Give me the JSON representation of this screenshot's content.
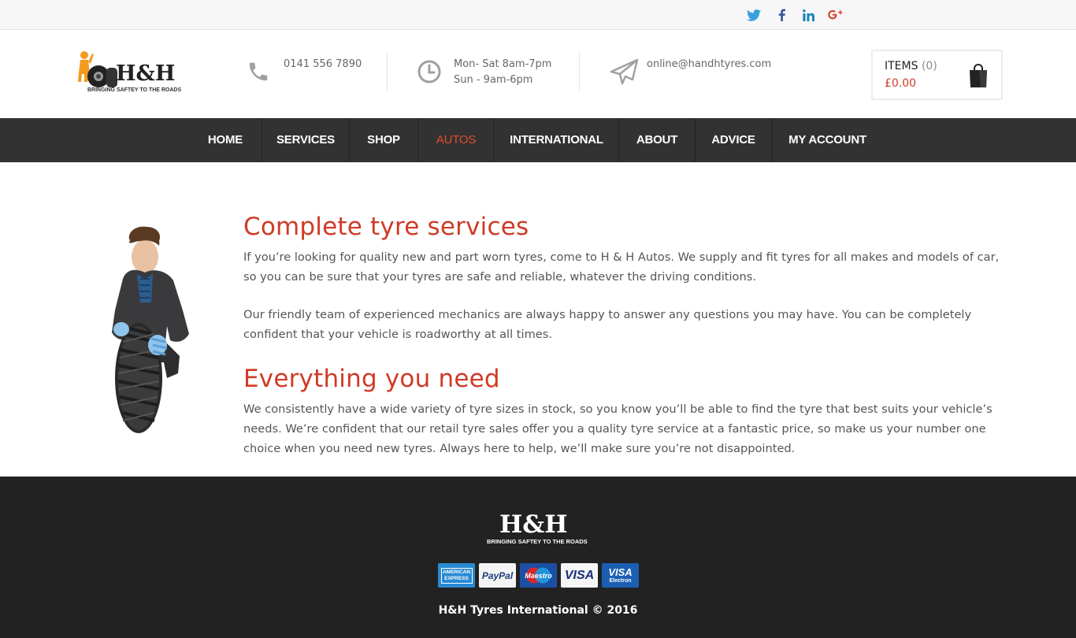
{
  "topbar": {
    "social": [
      {
        "name": "twitter-icon",
        "color": "#3aa0dd"
      },
      {
        "name": "facebook-icon",
        "color": "#3b5a9a"
      },
      {
        "name": "linkedin-icon",
        "color": "#1d84bd"
      },
      {
        "name": "google-plus-icon",
        "color": "#d3452f"
      }
    ]
  },
  "header": {
    "logo": {
      "text": "H&H",
      "tagline": "BRINGING SAFTEY TO THE ROADS"
    },
    "phone": {
      "icon": "phone-icon",
      "text": "0141 556 7890"
    },
    "hours": {
      "icon": "clock-icon",
      "line1": "Mon- Sat 8am-7pm",
      "line2": "Sun - 9am-6pm"
    },
    "email": {
      "icon": "paper-plane-icon",
      "text": "online@handhtyres.com"
    },
    "cart": {
      "label": "ITEMS",
      "count": "(0)",
      "total": "£0.00",
      "icon": "shopping-bag-icon"
    }
  },
  "nav": {
    "items": [
      {
        "label": "HOME"
      },
      {
        "label": "SERVICES"
      },
      {
        "label": "SHOP"
      },
      {
        "label": "AUTOS",
        "active": true
      },
      {
        "label": "INTERNATIONAL"
      },
      {
        "label": "ABOUT"
      },
      {
        "label": "ADVICE"
      },
      {
        "label": "MY ACCOUNT"
      }
    ],
    "active_color": "#e44b2f"
  },
  "main": {
    "section1": {
      "heading": "Complete tyre services",
      "para1": "If you’re looking for quality new and part worn tyres, come to H & H Autos. We supply and fit tyres for all makes and models of car, so you can be sure that your tyres are safe and reliable, whatever the driving conditions.",
      "para2": "Our friendly team of experienced mechanics are always happy to answer any questions you may have. You can be completely confident that your vehicle is roadworthy at all times."
    },
    "section2": {
      "heading": "Everything you need",
      "para1": "We consistently have a wide variety of tyre sizes in stock, so you know you’ll be able to find the tyre that best suits your vehicle’s needs. We’re confident that our retail tyre sales offer you a quality tyre service at a fantastic price, so make us your number one choice when you need new tyres. Always here to help, we’ll make sure you’re not disappointed."
    },
    "accent_color": "#d03a26"
  },
  "footer": {
    "logo": {
      "text": "H&H",
      "tagline": "BRINGING SAFTEY TO THE ROADS"
    },
    "cards": [
      {
        "label": "AMERICAN EXPRESS",
        "name": "amex-card-icon"
      },
      {
        "label": "PayPal",
        "name": "paypal-card-icon"
      },
      {
        "label": "Maestro",
        "name": "maestro-card-icon"
      },
      {
        "label": "VISA",
        "name": "visa-card-icon"
      },
      {
        "label": "VISA",
        "sub": "Electron",
        "name": "visa-electron-card-icon"
      }
    ],
    "copyright": "H&H Tyres International © 2016"
  }
}
